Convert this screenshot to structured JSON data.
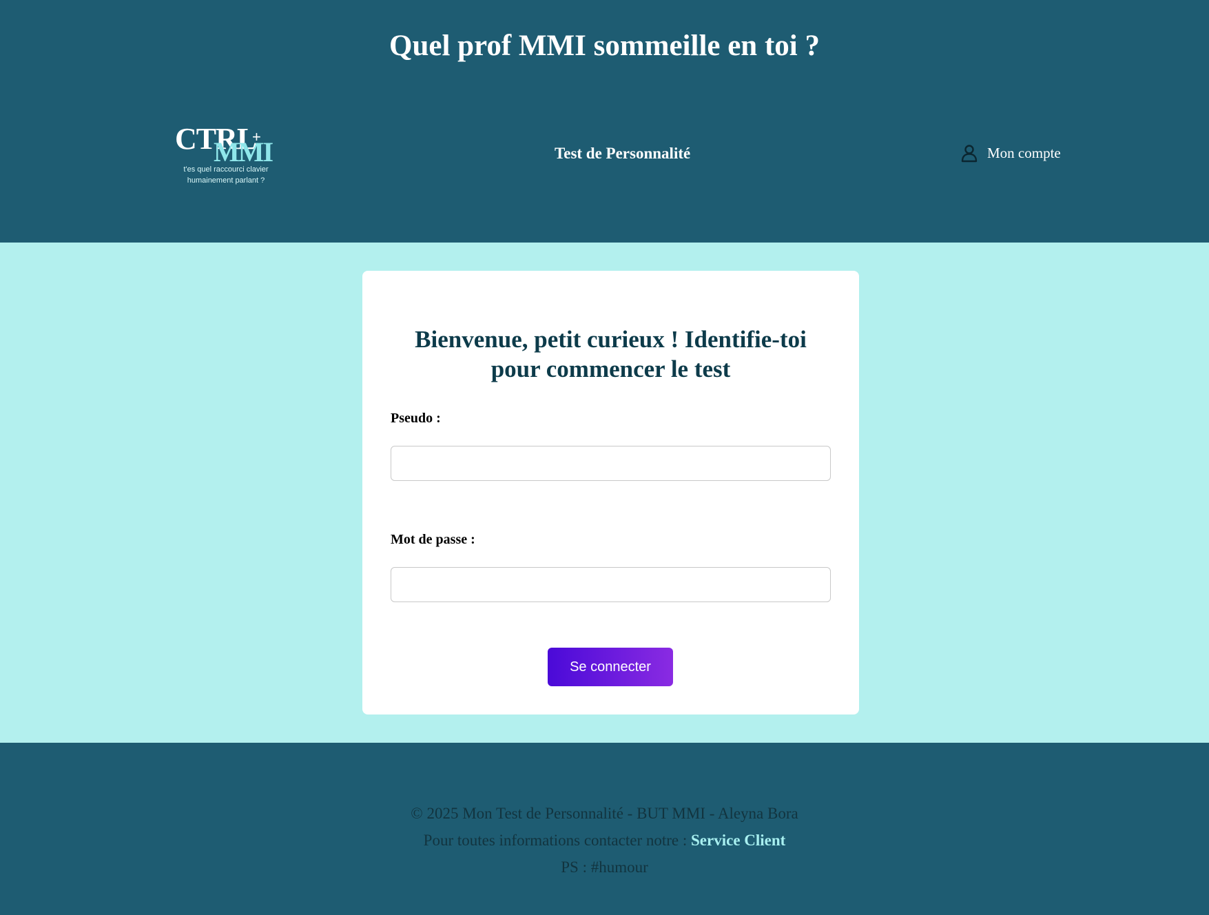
{
  "header": {
    "site_title": "Quel prof MMI sommeille en toi ?",
    "logo": {
      "line1": "CTRL",
      "line2": "MMI",
      "plus": "+",
      "tagline_1": "t'es quel raccourci clavier",
      "tagline_2": "humainement parlant ?"
    },
    "nav_link": "Test de Personnalité",
    "account_label": "Mon compte",
    "account_icon": "user-icon"
  },
  "login": {
    "heading_line1": "Bienvenue, petit curieux ! Identifie-toi",
    "heading_line2": "pour commencer le test",
    "pseudo_label": "Pseudo :",
    "pseudo_value": "",
    "password_label": "Mot de passe :",
    "password_value": "",
    "submit_label": "Se connecter"
  },
  "footer": {
    "copyright": "© 2025 Mon Test de Personnalité - BUT MMI - Aleyna Bora",
    "contact_prefix": "Pour toutes informations contacter notre : ",
    "contact_link": "Service Client",
    "ps": "PS : #humour"
  },
  "colors": {
    "header_bg": "#1e5c72",
    "page_bg": "#b3f0ee",
    "heading": "#0d3b4a",
    "button_start": "#4a0ad8",
    "button_end": "#8a2be2",
    "link": "#a8f0f0"
  }
}
